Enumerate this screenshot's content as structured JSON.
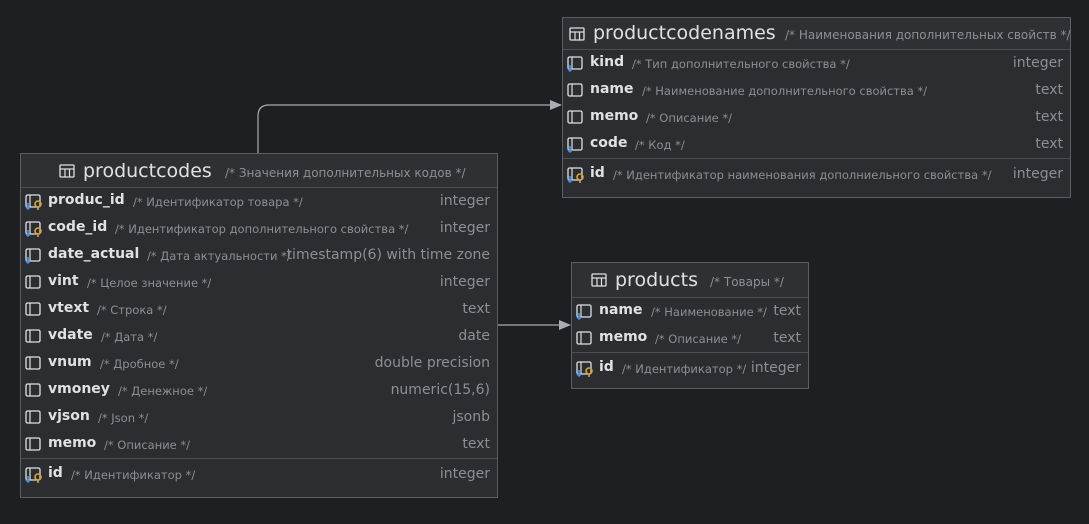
{
  "tables": {
    "productcodenames": {
      "name": "productcodenames",
      "comment": "/* Наименования дополнительных свойств */",
      "columns": [
        {
          "name": "kind",
          "comment": "/* Тип дополнительного свойства */",
          "type": "integer",
          "icon": "fk-column-icon"
        },
        {
          "name": "name",
          "comment": "/* Наименование дополнительного свойства */",
          "type": "text",
          "icon": "column-icon"
        },
        {
          "name": "memo",
          "comment": "/* Описание */",
          "type": "text",
          "icon": "column-icon"
        },
        {
          "name": "code",
          "comment": "/* Код */",
          "type": "text",
          "icon": "fk-column-icon"
        }
      ],
      "pk": {
        "name": "id",
        "comment": "/* Идентификатор наименования дополниельного свойства */",
        "type": "integer",
        "icon": "pk-column-icon"
      }
    },
    "productcodes": {
      "name": "productcodes",
      "comment": "/* Значения дополнительных кодов */",
      "columns": [
        {
          "name": "produc_id",
          "comment": "/* Идентификатор товара */",
          "type": "integer",
          "icon": "pk-fk-column-icon"
        },
        {
          "name": "code_id",
          "comment": "/* Идентификатор дополнительного свойства */",
          "type": "integer",
          "icon": "pk-fk-column-icon"
        },
        {
          "name": "date_actual",
          "comment": "/* Дата актуальности */",
          "type": "timestamp(6) with time zone",
          "icon": "fk-column-icon"
        },
        {
          "name": "vint",
          "comment": "/* Целое значение */",
          "type": "integer",
          "icon": "column-icon"
        },
        {
          "name": "vtext",
          "comment": "/* Строка */",
          "type": "text",
          "icon": "column-icon"
        },
        {
          "name": "vdate",
          "comment": "/* Дата */",
          "type": "date",
          "icon": "column-icon"
        },
        {
          "name": "vnum",
          "comment": "/* Дробное */",
          "type": "double precision",
          "icon": "column-icon"
        },
        {
          "name": "vmoney",
          "comment": "/* Денежное */",
          "type": "numeric(15,6)",
          "icon": "column-icon"
        },
        {
          "name": "vjson",
          "comment": "/* Json */",
          "type": "jsonb",
          "icon": "column-icon"
        },
        {
          "name": "memo",
          "comment": "/* Описание */",
          "type": "text",
          "icon": "column-icon"
        }
      ],
      "pk": {
        "name": "id",
        "comment": "/* Идентификатор */",
        "type": "integer",
        "icon": "pk-column-icon"
      }
    },
    "products": {
      "name": "products",
      "comment": "/* Товары */",
      "columns": [
        {
          "name": "name",
          "comment": "/* Наименование */",
          "type": "text",
          "icon": "fk-column-icon"
        },
        {
          "name": "memo",
          "comment": "/* Описание */",
          "type": "text",
          "icon": "column-icon"
        }
      ],
      "pk": {
        "name": "id",
        "comment": "/* Идентификатор */",
        "type": "integer",
        "icon": "pk-column-icon"
      }
    }
  },
  "colors": {
    "background": "#1e1f22",
    "table_bg": "#2b2d30",
    "border": "#5b5e63",
    "text": "#dfe1e5",
    "muted": "#8c8f94",
    "key_blue": "#4a8fe0",
    "key_gold": "#d9a43b",
    "connector": "#a9acb0"
  }
}
